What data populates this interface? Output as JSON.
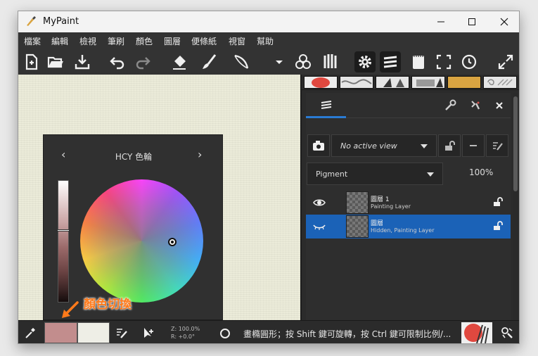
{
  "window": {
    "title": "MyPaint"
  },
  "menu": [
    "檔案",
    "編輯",
    "檢視",
    "筆刷",
    "顏色",
    "圖層",
    "便條紙",
    "視窗",
    "幫助"
  ],
  "color_panel": {
    "title": "HCY 色輪",
    "prev_arrow": "‹",
    "next_arrow": "›"
  },
  "annotation": {
    "text": "顏色切換"
  },
  "layers_panel": {
    "view_label": "No active view",
    "blend_mode": "Pigment",
    "opacity": "100%",
    "layers": [
      {
        "name": "圖層 1",
        "desc": "Painting Layer",
        "visible": true,
        "selected": false
      },
      {
        "name": "圖層",
        "desc": "Hidden, Painting Layer",
        "visible": false,
        "selected": true
      }
    ]
  },
  "status": {
    "zoom": "Z: 100.0%",
    "rotation": "R: +0.0°",
    "message": "畫橢圓形；按 Shift 鍵可旋轉，按 Ctrl 鍵可限制比例/..."
  },
  "colors": {
    "foreground": "#c28d8d",
    "background": "#eeeee6",
    "accent": "#1b62b7"
  }
}
